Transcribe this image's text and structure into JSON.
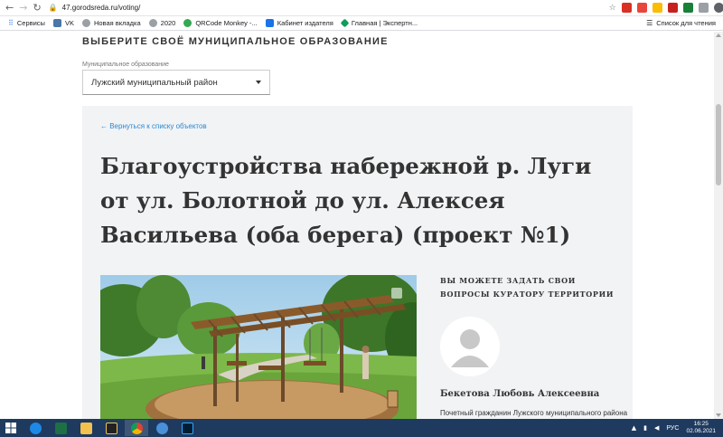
{
  "browser": {
    "url": "47.gorodsreda.ru/voting/",
    "bookmarks": [
      {
        "label": "Сервисы",
        "color": "#4285f4"
      },
      {
        "label": "VK",
        "color": "#4a76a8"
      },
      {
        "label": "Новая вкладка",
        "color": "#5f6368"
      },
      {
        "label": "2020",
        "color": "#5f6368"
      },
      {
        "label": "QRCode Monkey -...",
        "color": "#34a853"
      },
      {
        "label": "Кабинет издателя",
        "color": "#1a73e8"
      },
      {
        "label": "Главная | Экспертн...",
        "color": "#0f9d58"
      }
    ],
    "reading_list": "Список для чтения"
  },
  "page": {
    "section_title": "ВЫБЕРИТЕ СВОЁ МУНИЦИПАЛЬНОЕ ОБРАЗОВАНИЕ",
    "select_label": "Муниципальное образование",
    "select_value": "Лужский муниципальный район",
    "back_link": "← Вернуться к списку объектов",
    "title": "Благоустройства набережной р. Луги от ул. Болотной до ул. Алексея Васильева (оба берега) (проект №1)",
    "side_title": "ВЫ МОЖЕТЕ ЗАДАТЬ СВОИ ВОПРОСЫ КУРАТОРУ ТЕРРИТОРИИ",
    "curator_name": "Бекетова Любовь Алексеевна",
    "curator_role": "Почетный гражданин Лужского муниципального района"
  },
  "taskbar": {
    "language": "РУС",
    "time": "16:25",
    "date": "02.06.2021"
  },
  "colors": {
    "accent_link": "#2a8ad1",
    "card_bg": "#f2f3f5",
    "taskbar_bg": "#1e3a5f"
  }
}
